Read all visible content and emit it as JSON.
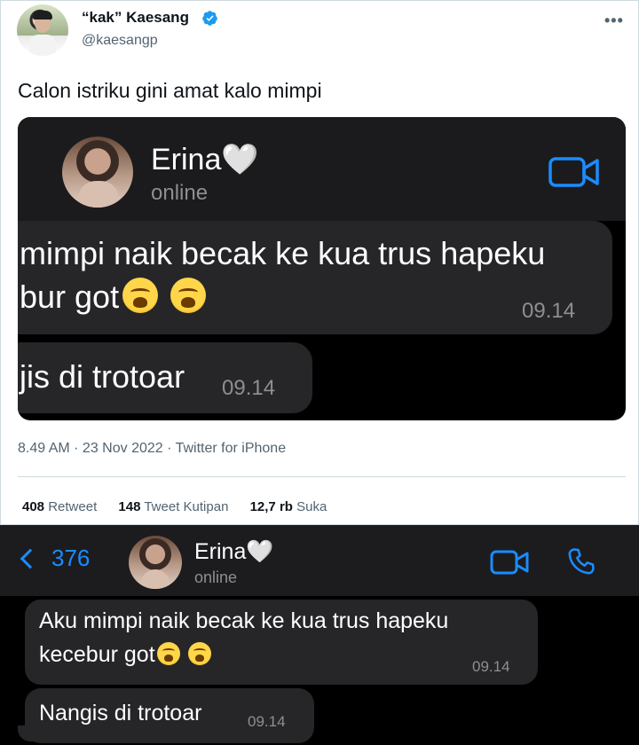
{
  "tweet": {
    "display_name": "“kak” Kaesang",
    "handle": "@kaesangp",
    "text": "Calon istriku gini amat kalo mimpi",
    "meta": "8.49 AM · 23 Nov 2022 · Twitter for iPhone",
    "stats": {
      "retweet_count": "408",
      "retweet_label": "Retweet",
      "quote_count": "148",
      "quote_label": "Tweet Kutipan",
      "like_count": "12,7 rb",
      "like_label": "Suka"
    },
    "embedded_chat": {
      "contact_name": "Erina🤍",
      "status": "online",
      "message1_line1": "mimpi naik becak ke kua trus hapeku",
      "message1_line2": "bur got",
      "message1_time": "09.14",
      "message2": "jis di trotoar",
      "message2_time": "09.14"
    }
  },
  "chat": {
    "back_count": "376",
    "contact_name": "Erina🤍",
    "status": "online",
    "message1_line1": "Aku mimpi naik becak ke kua trus hapeku",
    "message1_line2": "kecebur got",
    "message1_time": "09.14",
    "message2": "Nangis di trotoar",
    "message2_time": "09.14"
  },
  "icons": {
    "verified": "verified-badge-icon",
    "more": "more-icon",
    "video": "video-call-icon",
    "phone": "phone-call-icon",
    "back": "chevron-left-icon",
    "emoji": "loudly-crying-face-emoji"
  },
  "colors": {
    "twitter_blue": "#1d9bf0",
    "ios_blue": "#1a8cff",
    "bubble_gray": "#262628"
  }
}
